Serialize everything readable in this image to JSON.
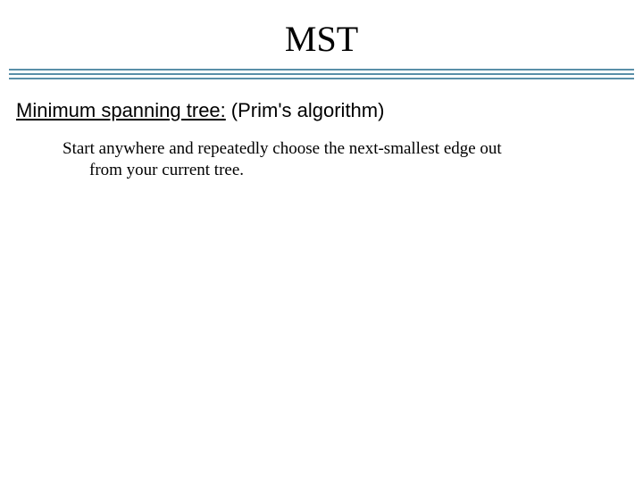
{
  "title": "MST",
  "subtitle": {
    "underlined": "Minimum spanning tree:",
    "rest": "(Prim's algorithm)"
  },
  "body": "Start anywhere and repeatedly choose the next-smallest edge out from your current tree."
}
